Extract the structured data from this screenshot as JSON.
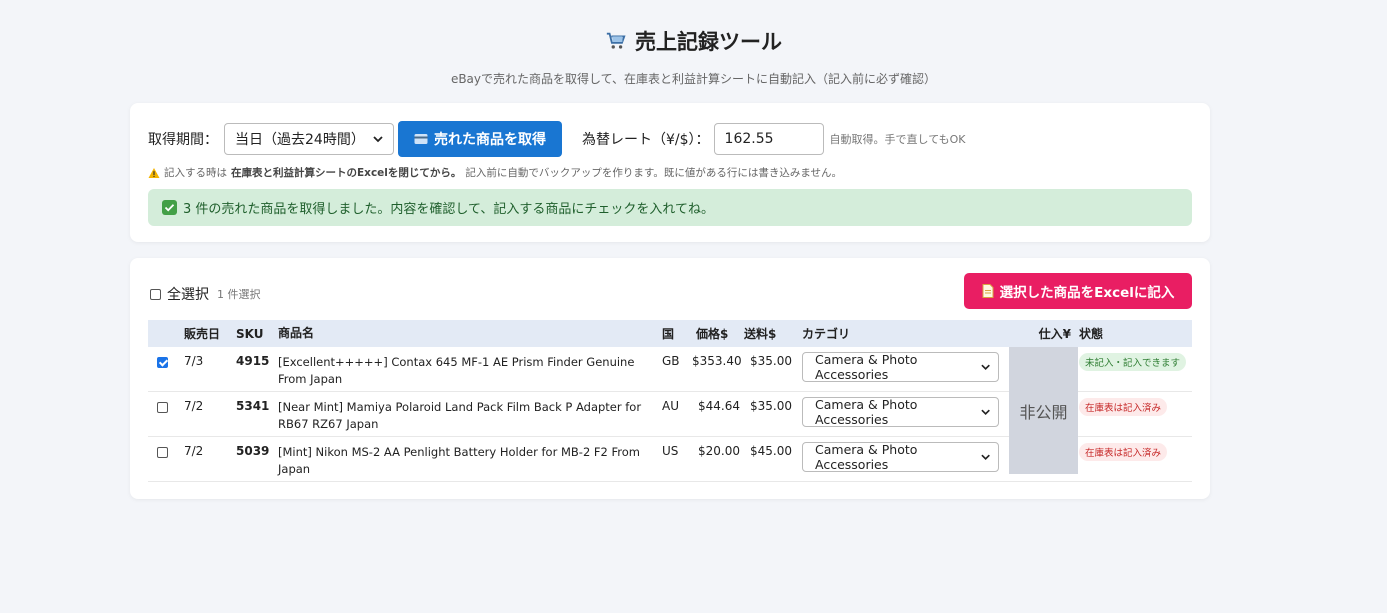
{
  "header": {
    "title": "売上記録ツール",
    "subtitle": "eBayで売れた商品を取得して、在庫表と利益計算シートに自動記入（記入前に必ず確認）"
  },
  "controls": {
    "period_label": "取得期間：",
    "period_selected": "当日（過去24時間）",
    "fetch_button": "売れた商品を取得",
    "rate_label": "為替レート（¥/$）：",
    "rate_value": "162.55",
    "rate_note": "自動取得。手で直してもOK",
    "warning_prefix": "記入する時は",
    "warning_bold": "在庫表と利益計算シートのExcelを閉じてから。",
    "warning_suffix": "記入前に自動でバックアップを作ります。既に値がある行には書き込みません。",
    "success_message": "3 件の売れた商品を取得しました。内容を確認して、記入する商品にチェックを入れてね。"
  },
  "list": {
    "select_all_label": "全選択",
    "selected_count": "1 件選択",
    "excel_button": "選択した商品をExcelに記入",
    "columns": {
      "date": "販売日",
      "sku": "SKU",
      "name": "商品名",
      "country": "国",
      "price": "価格$",
      "shipping": "送料$",
      "category": "カテゴリ",
      "cost": "仕入¥",
      "status": "状態"
    },
    "cost_hidden_label": "非公開",
    "rows": [
      {
        "checked": true,
        "date": "7/3",
        "sku": "4915",
        "name": "[Excellent+++++] Contax 645 MF-1 AE Prism Finder Genuine From Japan",
        "country": "GB",
        "price": "$353.40",
        "shipping": "$35.00",
        "category": "Camera & Photo Accessories",
        "status": "未記入・記入できます",
        "status_kind": "green"
      },
      {
        "checked": false,
        "date": "7/2",
        "sku": "5341",
        "name": "[Near Mint] Mamiya Polaroid Land Pack Film Back P Adapter for RB67 RZ67 Japan",
        "country": "AU",
        "price": "$44.64",
        "shipping": "$35.00",
        "category": "Camera & Photo Accessories",
        "status": "在庫表は記入済み",
        "status_kind": "red"
      },
      {
        "checked": false,
        "date": "7/2",
        "sku": "5039",
        "name": "[Mint] Nikon MS-2 AA Penlight Battery Holder for MB-2 F2 From Japan",
        "country": "US",
        "price": "$20.00",
        "shipping": "$45.00",
        "category": "Camera & Photo Accessories",
        "status": "在庫表は記入済み",
        "status_kind": "red"
      }
    ]
  },
  "colors": {
    "primary_blue": "#1976d2",
    "excel_pink": "#e91e63",
    "success_bg": "#d4edda",
    "header_row_bg": "#e3eaf5"
  }
}
